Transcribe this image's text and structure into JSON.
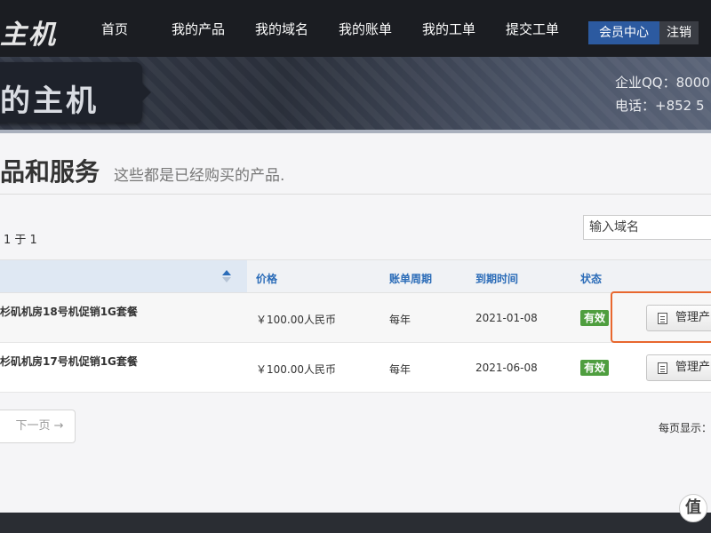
{
  "brand": {
    "logo_text": "主机"
  },
  "nav": {
    "items": [
      {
        "label": "首页"
      },
      {
        "label": "我的产品"
      },
      {
        "label": "我的域名"
      },
      {
        "label": "我的账单"
      },
      {
        "label": "我的工单"
      },
      {
        "label": "提交工单"
      }
    ],
    "member_center": "会员中心",
    "logout": "注销"
  },
  "banner": {
    "title": "的主机",
    "qq": "企业QQ：8000",
    "phone": "电话：+852 5"
  },
  "page": {
    "heading": "品和服务",
    "subheading": "这些都是已经购买的产品.",
    "count_text": "1 于 1"
  },
  "search": {
    "placeholder": "输入域名"
  },
  "table": {
    "headers": {
      "price": "价格",
      "cycle": "账单周期",
      "due": "到期时间",
      "status": "状态"
    },
    "rows": [
      {
        "name": "杉矶机房18号机促销1G套餐",
        "price": "￥100.00人民币",
        "cycle": "每年",
        "due": "2021-01-08",
        "status": "有效",
        "action": "管理产品"
      },
      {
        "name": "杉矶机房17号机促销1G套餐",
        "price": "￥100.00人民币",
        "cycle": "每年",
        "due": "2021-06-08",
        "status": "有效",
        "action": "管理产品"
      }
    ]
  },
  "pagination": {
    "next_label": "下一页 →",
    "per_page_label": "每页显示："
  },
  "watermark": "值"
}
